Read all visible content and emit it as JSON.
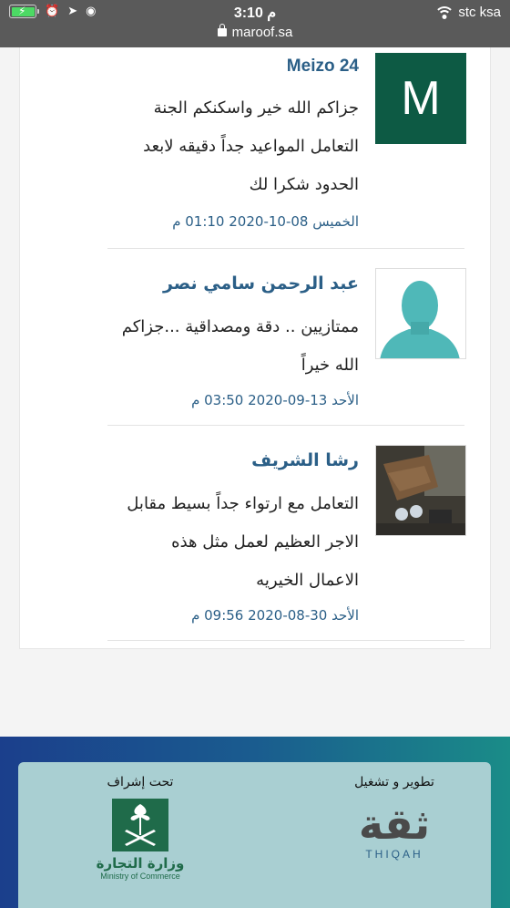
{
  "status_bar": {
    "time": "3:10 م",
    "carrier": "stc ksa",
    "url": "maroof.sa"
  },
  "reviews": [
    {
      "name": "Meizo 24",
      "avatar_letter": "M",
      "lines": [
        "جزاكم الله خير واسكنكم الجنة",
        "التعامل المواعيد جداً دقيقه لابعد",
        "الحدود شكرا لك"
      ],
      "date": "الخميس 08-10-2020 01:10 م"
    },
    {
      "name": "عبد الرحمن سامي نصر",
      "lines": [
        "ممتازيين .. دقة ومصداقية ...جزاكم",
        "الله خيراً"
      ],
      "date": "الأحد 13-09-2020 03:50 م"
    },
    {
      "name": "رشا الشريف",
      "lines": [
        "التعامل مع ارتواء جداً بسيط مقابل",
        "الاجر العظيم لعمل مثل هذه",
        "الاعمال الخيريه"
      ],
      "date": "الأحد 30-08-2020 09:56 م"
    }
  ],
  "footer": {
    "developer_label": "تطوير و تشغيل",
    "developer_logo_en": "THIQAH",
    "developer_logo_ar": "ثقة",
    "supervisor_label": "تحت إشراف",
    "ministry_ar": "وزارة التجارة",
    "ministry_en": "Ministry of Commerce"
  },
  "colors": {
    "name": "#2b5f87",
    "avatar_m": "#0d5a44",
    "avatar_person": "#4fb8b8",
    "footer_box": "#a9cfd2",
    "ministry_green": "#1f6b4a"
  }
}
